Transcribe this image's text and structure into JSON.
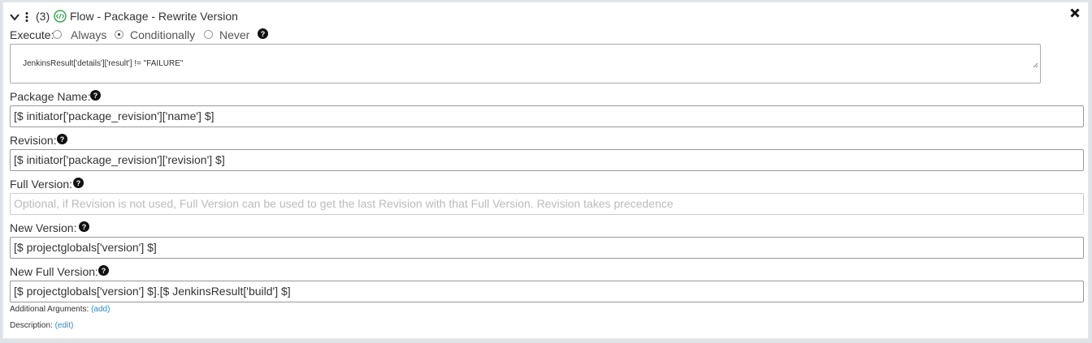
{
  "header": {
    "step_number": "(3)",
    "title": "Flow - Package - Rewrite Version"
  },
  "execute": {
    "label": "Execute:",
    "options": [
      "Always",
      "Conditionally",
      "Never"
    ],
    "selected": "Conditionally",
    "condition": "JenkinsResult['details']['result'] != \"FAILURE\""
  },
  "fields": {
    "package_name": {
      "label": "Package Name:",
      "value": "[$ initiator['package_revision']['name'] $]"
    },
    "revision": {
      "label": "Revision:",
      "value": "[$ initiator['package_revision']['revision'] $]"
    },
    "full_version": {
      "label": "Full Version:",
      "value": "",
      "placeholder": "Optional, if Revision is not used, Full Version can be used to get the last Revision with that Full Version. Revision takes precedence"
    },
    "new_version": {
      "label": "New Version:",
      "value": "[$ projectglobals['version'] $]"
    },
    "new_full_version": {
      "label": "New Full Version:",
      "value": "[$ projectglobals['version'] $].[$ JenkinsResult['build'] $]"
    }
  },
  "additional_arguments": {
    "label": "Additional Arguments:",
    "link": "(add)"
  },
  "description": {
    "label": "Description:",
    "link": "(edit)"
  },
  "icons": [
    "chevron-down-icon",
    "vertical-dots-icon",
    "code-flow-icon",
    "close-icon",
    "help-icon"
  ],
  "colors": {
    "accent_link": "#2a8bcf",
    "flow_icon": "#3aa655",
    "border": "#999999",
    "placeholder": "#bbbbbb"
  }
}
